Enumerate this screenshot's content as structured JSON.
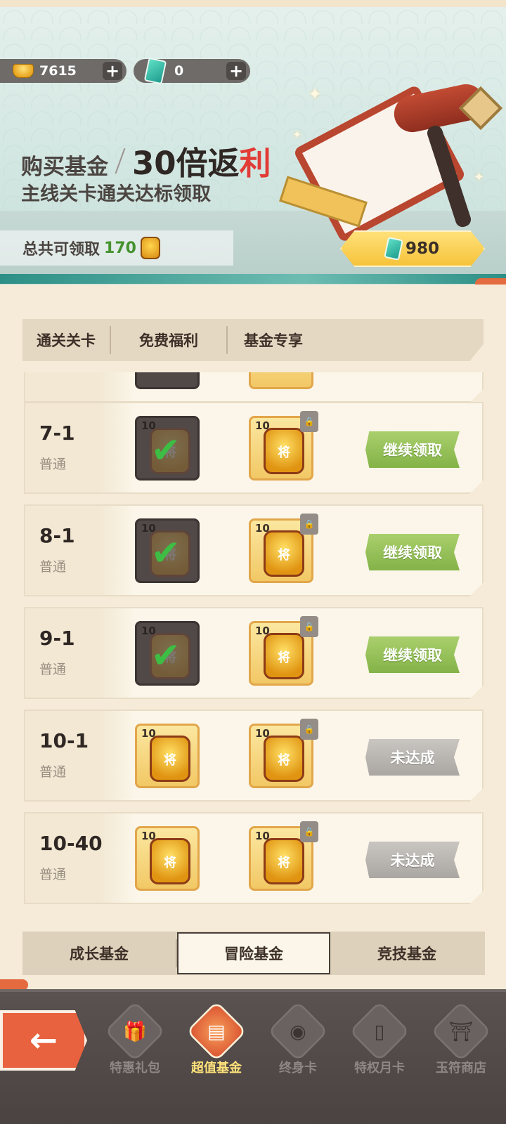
{
  "header": {
    "gold": {
      "icon": "gold-ingot-icon",
      "amount": "7615",
      "add_label": "+"
    },
    "jade": {
      "icon": "jade-token-icon",
      "amount": "0",
      "add_label": "+"
    }
  },
  "banner": {
    "title_left": "购买基金",
    "title_big": "30倍返",
    "title_big_accent": "利",
    "subtitle": "主线关卡通关达标领取",
    "total_label": "总共可领取",
    "total_amount": "170",
    "price": "980",
    "accent_color": "#e23b36"
  },
  "columns": {
    "stage": "通关关卡",
    "free": "免费福利",
    "fund": "基金专享"
  },
  "rows": [
    {
      "stage": "7-1",
      "difficulty": "普通",
      "free_qty": "10",
      "free_token": "将",
      "free_claimed": true,
      "fund_qty": "10",
      "fund_token": "将",
      "status": "继续领取"
    },
    {
      "stage": "8-1",
      "difficulty": "普通",
      "free_qty": "10",
      "free_token": "将",
      "free_claimed": true,
      "fund_qty": "10",
      "fund_token": "将",
      "status": "继续领取"
    },
    {
      "stage": "9-1",
      "difficulty": "普通",
      "free_qty": "10",
      "free_token": "将",
      "free_claimed": true,
      "fund_qty": "10",
      "fund_token": "将",
      "status": "继续领取"
    },
    {
      "stage": "10-1",
      "difficulty": "普通",
      "free_qty": "10",
      "free_token": "将",
      "free_claimed": false,
      "fund_qty": "10",
      "fund_token": "将",
      "status": "未达成"
    },
    {
      "stage": "10-40",
      "difficulty": "普通",
      "free_qty": "10",
      "free_token": "将",
      "free_claimed": false,
      "fund_qty": "10",
      "fund_token": "将",
      "status": "未达成"
    }
  ],
  "fund_tabs": [
    {
      "label": "成长基金",
      "active": false
    },
    {
      "label": "冒险基金",
      "active": true
    },
    {
      "label": "竞技基金",
      "active": false
    }
  ],
  "bottom_nav": {
    "back_icon": "back-arrow-icon",
    "items": [
      {
        "label": "特惠礼包",
        "icon": "gift-icon",
        "active": false
      },
      {
        "label": "超值基金",
        "icon": "fund-box-icon",
        "active": true
      },
      {
        "label": "终身卡",
        "icon": "lifetime-card-icon",
        "active": false
      },
      {
        "label": "特权月卡",
        "icon": "monthly-card-icon",
        "active": false
      },
      {
        "label": "玉符商店",
        "icon": "shop-icon",
        "active": false
      }
    ]
  },
  "colors": {
    "claim_green": "#8fbe52",
    "not_reached_grey": "#b5b1ad",
    "total_green": "#45922f"
  }
}
